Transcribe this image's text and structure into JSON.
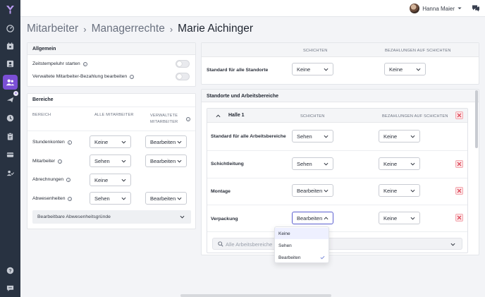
{
  "header": {
    "user_name": "Hanna Maier"
  },
  "breadcrumb": {
    "items": [
      "Mitarbeiter",
      "Managerrechte",
      "Marie Aichinger"
    ]
  },
  "allgemein": {
    "title": "Allgemein",
    "rows": [
      {
        "label": "Zeitstempeluhr starten",
        "enabled": false
      },
      {
        "label": "Verwaltete Mitarbeiter-Bezahlung bearbeiten",
        "enabled": false
      }
    ]
  },
  "bereiche": {
    "title": "Bereiche",
    "col_bereich": "BEREICH",
    "col_alle": "ALLE MITARBEITER",
    "col_verwaltete": "VERWALTETE MITARBEITER",
    "rows": [
      {
        "label": "Stundenkonten",
        "alle": "Keine",
        "verwaltete": "Bearbeiten"
      },
      {
        "label": "Mitarbeiter",
        "alle": "Sehen",
        "verwaltete": "Bearbeiten"
      },
      {
        "label": "Abrechnungen",
        "alle": "Keine",
        "verwaltete": ""
      },
      {
        "label": "Abwesenheiten",
        "alle": "Sehen",
        "verwaltete": "Bearbeiten"
      }
    ],
    "collapsible": "Bearbeitbare Abwesenheitsgründe"
  },
  "standard": {
    "col_schichten": "SCHICHTEN",
    "col_bezahlungen": "BEZAHLUNGEN AUF SCHICHTEN",
    "label": "Standard für alle Standorte",
    "schichten": "Keine",
    "bezahlungen": "Keine"
  },
  "standorte": {
    "title": "Standorte und Arbeitsbereiche",
    "halle": {
      "name": "Halle 1",
      "col_schichten": "SCHICHTEN",
      "col_bezahlungen": "BEZAHLUNGEN AUF SCHICHTEN",
      "rows": [
        {
          "label": "Standard für alle Arbeitsbereiche",
          "schichten": "Sehen",
          "bezahlungen": "Keine"
        },
        {
          "label": "Schichtleitung",
          "schichten": "Sehen",
          "bezahlungen": "Keine"
        },
        {
          "label": "Montage",
          "schichten": "Bearbeiten",
          "bezahlungen": "Keine"
        },
        {
          "label": "Verpackung",
          "schichten": "Bearbeiten",
          "bezahlungen": "Keine"
        }
      ],
      "search_placeholder": "Alle Arbeitsbereiche"
    },
    "dropdown_options": [
      "Keine",
      "Sehen",
      "Bearbeiten"
    ],
    "dropdown_selected": "Bearbeiten"
  },
  "colors": {
    "rail": "#283241",
    "accent": "#7b4fd6",
    "danger": "#e04a5a"
  }
}
